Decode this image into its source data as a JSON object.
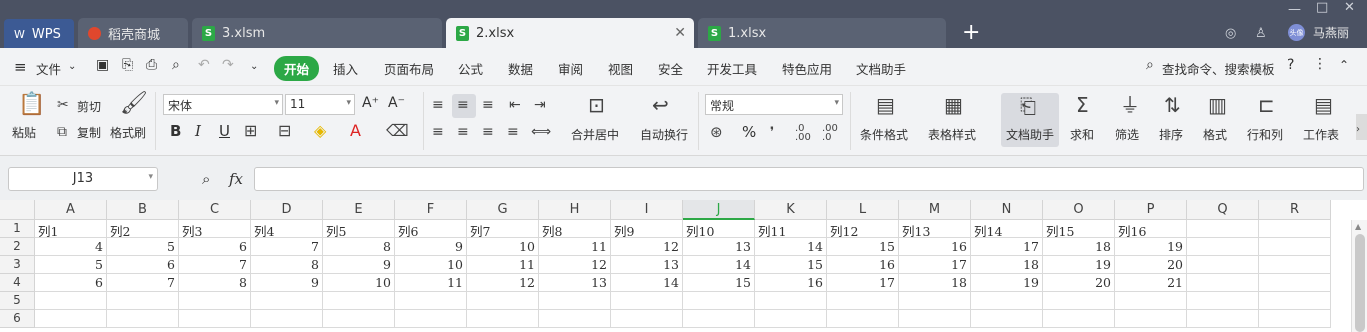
{
  "tabs": {
    "wps": "WPS",
    "store": "稻壳商城",
    "file3": "3.xlsm",
    "file2": "2.xlsx",
    "file1": "1.xlsx",
    "file_icon": "S",
    "close": "✕",
    "new_tab": "+"
  },
  "user": {
    "avatar": "头像",
    "name": "马燕丽"
  },
  "menu": {
    "file": "文件",
    "start": "开始",
    "items": [
      "插入",
      "页面布局",
      "公式",
      "数据",
      "审阅",
      "视图",
      "安全",
      "开发工具",
      "特色应用",
      "文档助手"
    ],
    "search": "查找命令、搜索模板",
    "help": "?"
  },
  "ribbon": {
    "paste": "粘贴",
    "cut": "剪切",
    "copy": "复制",
    "format_painter": "格式刷",
    "font": "宋体",
    "size": "11",
    "bold": "B",
    "italic": "I",
    "underline": "U",
    "merge": "合并居中",
    "wrap": "自动换行",
    "number_format": "常规",
    "cond_format": "条件格式",
    "table_style": "表格样式",
    "doc_helper": "文档助手",
    "sum": "求和",
    "filter": "筛选",
    "sort": "排序",
    "format": "格式",
    "row_col": "行和列",
    "worksheet": "工作表",
    "percent": "%",
    "font_grow": "A⁺",
    "font_shrink": "A⁻"
  },
  "formula": {
    "cell_ref": "J13",
    "fx": "fx",
    "value": ""
  },
  "sheet": {
    "columns": [
      "A",
      "B",
      "C",
      "D",
      "E",
      "F",
      "G",
      "H",
      "I",
      "J",
      "K",
      "L",
      "M",
      "N",
      "O",
      "P",
      "Q",
      "R"
    ],
    "active_column": "J",
    "rows": [
      "1",
      "2",
      "3",
      "4",
      "5",
      "6"
    ],
    "r1": [
      "列1",
      "列2",
      "列3",
      "列4",
      "列5",
      "列6",
      "列7",
      "列8",
      "列9",
      "列10",
      "列11",
      "列12",
      "列13",
      "列14",
      "列15",
      "列16"
    ],
    "r2": [
      "4",
      "5",
      "6",
      "7",
      "8",
      "9",
      "10",
      "11",
      "12",
      "13",
      "14",
      "15",
      "16",
      "17",
      "18",
      "19"
    ],
    "r3": [
      "5",
      "6",
      "7",
      "8",
      "9",
      "10",
      "11",
      "12",
      "13",
      "14",
      "15",
      "16",
      "17",
      "18",
      "19",
      "20"
    ],
    "r4": [
      "6",
      "7",
      "8",
      "9",
      "10",
      "11",
      "12",
      "13",
      "14",
      "15",
      "16",
      "17",
      "18",
      "19",
      "20",
      "21"
    ]
  },
  "colors": {
    "accent": "#2ca846",
    "titlebar": "#4b5263"
  }
}
